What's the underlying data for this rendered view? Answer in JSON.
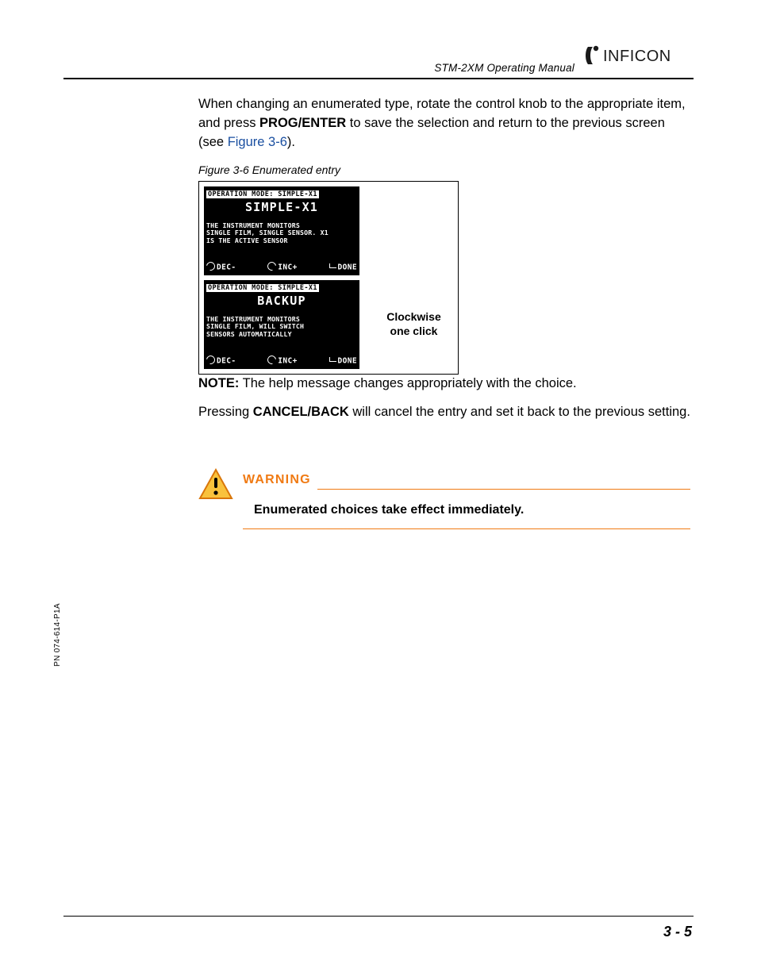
{
  "header": {
    "manual_title": "STM-2XM Operating Manual",
    "brand": "INFICON"
  },
  "para1": {
    "before_bold": "When changing an enumerated type, rotate the control knob to the appropriate item, and press ",
    "bold": "PROG/ENTER",
    "after_bold": " to save the selection and return to the previous screen (see ",
    "link": "Figure 3-6",
    "after_link": ")."
  },
  "figure": {
    "caption": "Figure 3-6  Enumerated entry",
    "screen1": {
      "header": "OPERATION MODE: SIMPLE-X1",
      "big": "SIMPLE-X1",
      "help_l1": "THE INSTRUMENT MONITORS",
      "help_l2": "SINGLE FILM, SINGLE SENSOR. X1",
      "help_l3": "IS THE ACTIVE SENSOR",
      "dec": "DEC-",
      "inc": "INC+",
      "done": "DONE"
    },
    "screen2": {
      "header": "OPERATION MODE: SIMPLE-X1",
      "big": "BACKUP",
      "help_l1": "THE INSTRUMENT MONITORS",
      "help_l2": "SINGLE FILM, WILL SWITCH",
      "help_l3": "SENSORS AUTOMATICALLY",
      "dec": "DEC-",
      "inc": "INC+",
      "done": "DONE"
    },
    "side_label_l1": "Clockwise",
    "side_label_l2": "one click"
  },
  "note": {
    "label": "NOTE:",
    "text": "  The help message changes appropriately with the choice."
  },
  "para2": {
    "before_bold": "Pressing ",
    "bold": "CANCEL/BACK",
    "after_bold": " will cancel the entry and set it back to the previous setting."
  },
  "warning": {
    "heading": "WARNING",
    "text": "Enumerated choices take effect immediately."
  },
  "side_pn": "PN 074-614-P1A",
  "footer": {
    "page": "3 - 5"
  }
}
